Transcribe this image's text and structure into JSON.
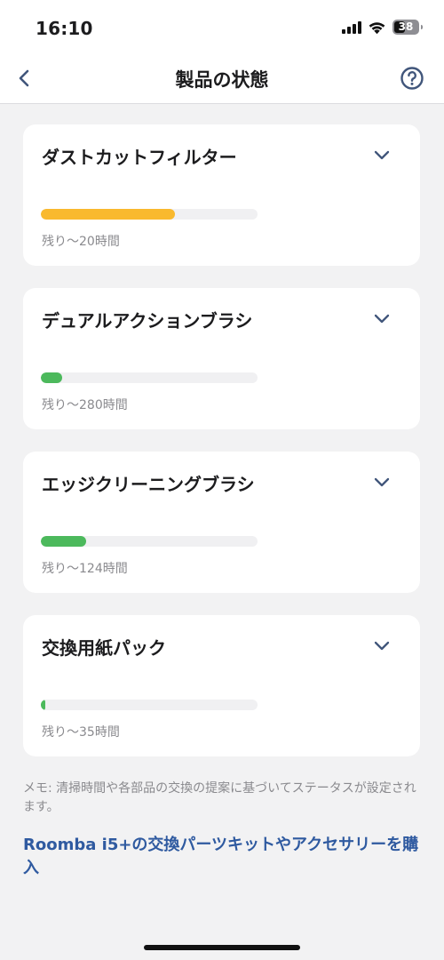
{
  "status_bar": {
    "time": "16:10",
    "battery": "38",
    "icons": [
      "signal-icon",
      "wifi-icon",
      "battery-icon"
    ]
  },
  "nav": {
    "title": "製品の状態",
    "back_icon": "chevron-left-icon",
    "help_icon": "question-circle-icon"
  },
  "colors": {
    "warning": "#f9b92e",
    "good": "#4cb95c",
    "track": "#f0f0f2",
    "link": "#2f5aa0",
    "icon_blue": "#41567b"
  },
  "parts": [
    {
      "name": "ダストカットフィルター",
      "remaining": "残り〜20時間",
      "level": 0.62,
      "status": "warning"
    },
    {
      "name": "デュアルアクションブラシ",
      "remaining": "残り〜280時間",
      "level": 0.1,
      "status": "good"
    },
    {
      "name": "エッジクリーニングブラシ",
      "remaining": "残り〜124時間",
      "level": 0.21,
      "status": "good"
    },
    {
      "name": "交換用紙パック",
      "remaining": "残り〜35時間",
      "level": 0.02,
      "status": "good"
    }
  ],
  "note": "メモ: 清掃時間や各部品の交換の提案に基づいてステータスが設定されます。",
  "shop_link": "Roomba i5+の交換パーツキットやアクセサリーを購入"
}
